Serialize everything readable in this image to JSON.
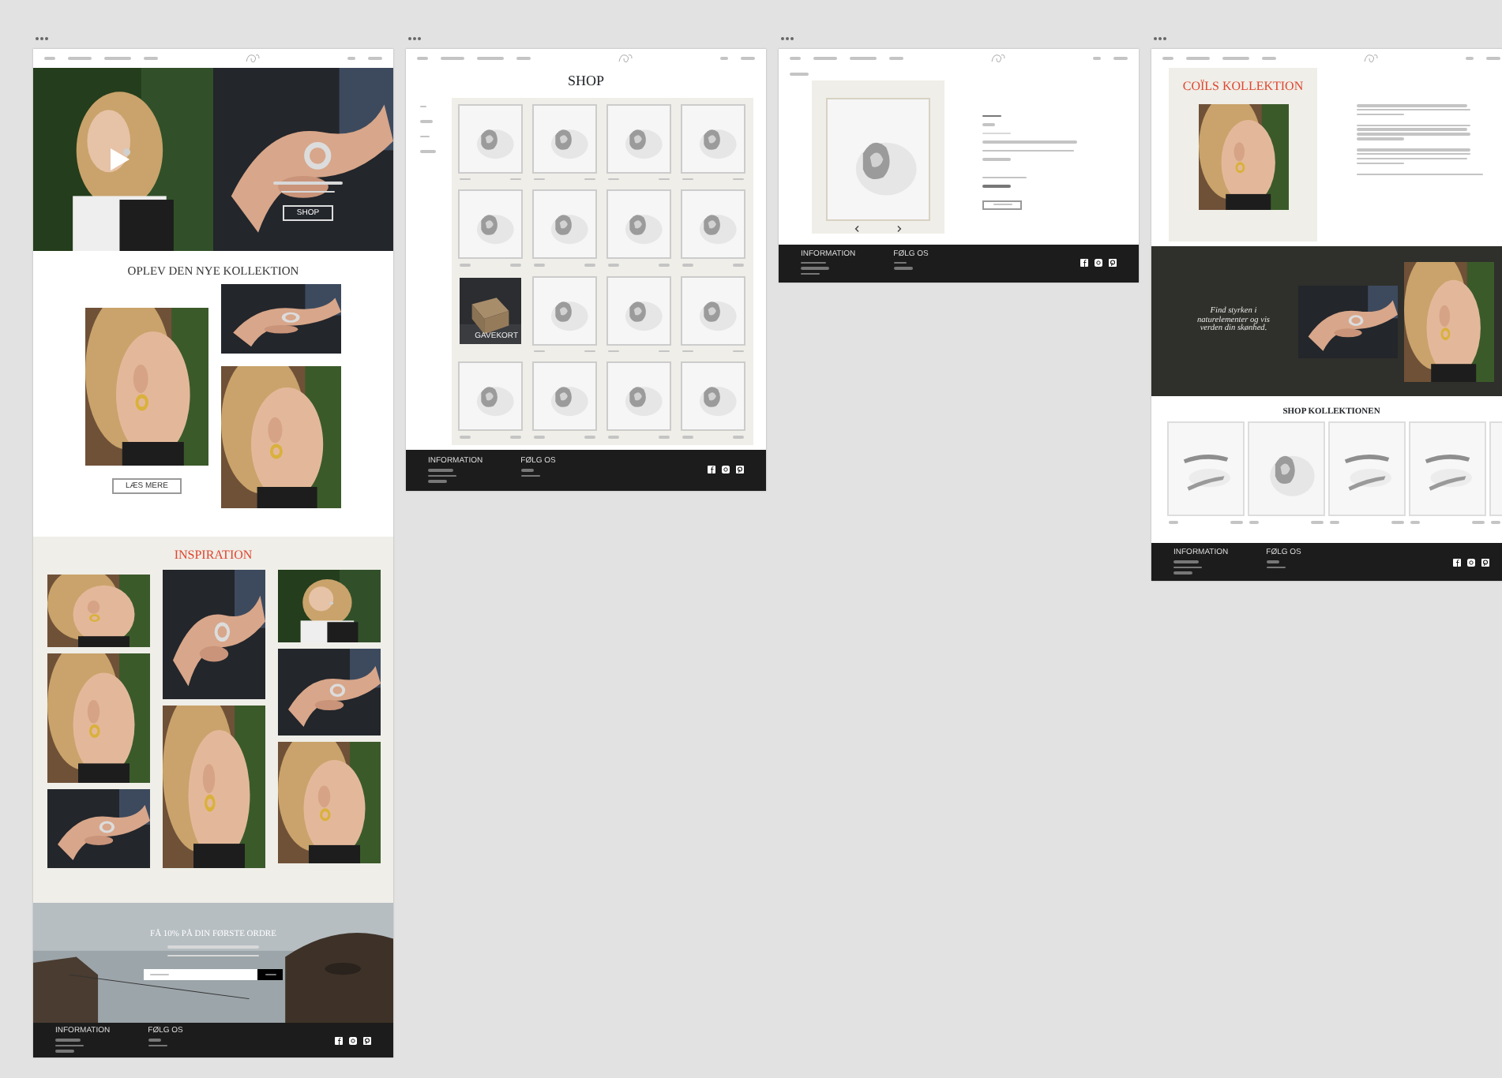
{
  "frames": [
    {
      "kind": "home",
      "hero": {
        "button": "SHOP"
      },
      "collection": {
        "title": "OPLEV DEN NYE KOLLEKTION",
        "button": "LÆS MERE"
      },
      "inspiration": {
        "title": "INSPIRATION"
      },
      "newsletter": {
        "title": "FÅ 10% PÅ DIN FØRSTE ORDRE"
      },
      "footer": {
        "columns": [
          "INFORMATION",
          "FØLG OS"
        ]
      }
    },
    {
      "kind": "shop",
      "title": "SHOP",
      "products": [
        {
          "kind": "product"
        },
        {
          "kind": "product"
        },
        {
          "kind": "product"
        },
        {
          "kind": "product"
        },
        {
          "kind": "product"
        },
        {
          "kind": "product"
        },
        {
          "kind": "product"
        },
        {
          "kind": "product"
        },
        {
          "kind": "giftcard",
          "label": "GAVEKORT"
        },
        {
          "kind": "product"
        },
        {
          "kind": "product"
        },
        {
          "kind": "product"
        },
        {
          "kind": "product"
        },
        {
          "kind": "product"
        },
        {
          "kind": "product"
        },
        {
          "kind": "product"
        }
      ],
      "footer": {
        "columns": [
          "INFORMATION",
          "FØLG OS"
        ]
      }
    },
    {
      "kind": "product_page",
      "footer": {
        "columns": [
          "INFORMATION",
          "FØLG OS"
        ]
      }
    },
    {
      "kind": "collection",
      "title": "COÏLS KOLLEKTION",
      "quote": "Find styrken i naturelementer og vis verden din skønhed.",
      "shop_title": "SHOP KOLLEKTIONEN",
      "footer": {
        "columns": [
          "INFORMATION",
          "FØLG OS"
        ]
      }
    }
  ]
}
